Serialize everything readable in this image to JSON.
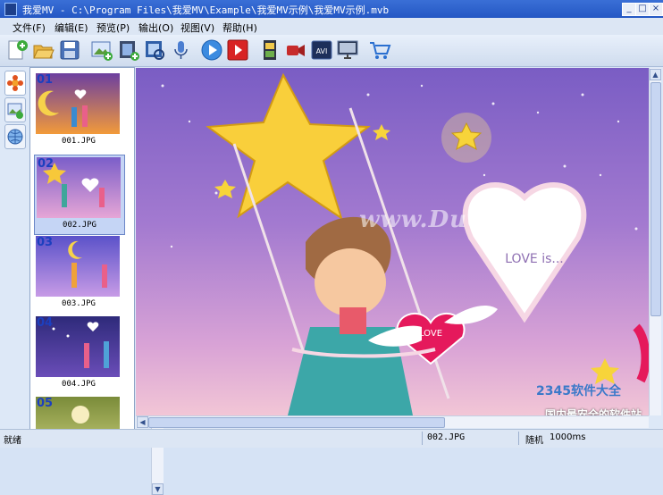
{
  "window": {
    "title": "我爱MV - C:\\Program Files\\我爱MV\\Example\\我爱MV示例\\我爱MV示例.mvb",
    "minimize": "_",
    "maximize": "□",
    "close": "×"
  },
  "menu": [
    {
      "label": "文件(F)"
    },
    {
      "label": "编辑(E)"
    },
    {
      "label": "预览(P)"
    },
    {
      "label": "输出(O)"
    },
    {
      "label": "视图(V)"
    },
    {
      "label": "帮助(H)"
    }
  ],
  "toolbar": {
    "icons": [
      "new-project-icon",
      "open-folder-icon",
      "save-icon",
      "add-picture-icon",
      "add-video-icon",
      "photo-album-icon",
      "microphone-icon",
      "play-icon",
      "record-play-icon",
      "film-strip-icon",
      "video-camera-icon",
      "avi-export-icon",
      "monitor-icon",
      "cart-icon"
    ]
  },
  "sidebar_tabs": [
    "flower-effect-icon",
    "picture-add-icon",
    "globe-icon"
  ],
  "thumbnails": [
    {
      "number": "01",
      "caption": "001.JPG"
    },
    {
      "number": "02",
      "caption": "002.JPG"
    },
    {
      "number": "03",
      "caption": "003.JPG"
    },
    {
      "number": "04",
      "caption": "004.JPG"
    },
    {
      "number": "05",
      "caption": ""
    }
  ],
  "preview": {
    "heart_text": "LOVE is...",
    "badge_text": "LOVE",
    "watermark": "www.DuoTe.com",
    "corner_watermark_line1": "2345软件大全",
    "corner_watermark_line2": "国内最安全的软件站"
  },
  "status": {
    "state": "就绪",
    "current_file": "002.JPG",
    "mode": "随机",
    "duration": "1000ms"
  },
  "colors": {
    "titlebar": "#2a5dc8",
    "thumb_number": "#1c3fbf",
    "selected_thumb": "#c5d5f5"
  }
}
